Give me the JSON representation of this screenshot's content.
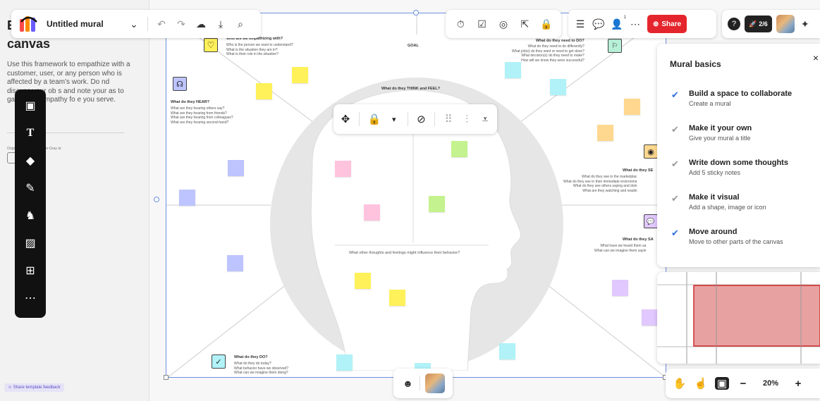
{
  "left_panel": {
    "title_visible": "E",
    "title_line2": "canvas",
    "description": "Use this framework to empathize with a customer, user, or any person who is affected by a team's work. Do   nd discuss your ob   s and note your as   to gain more empathy fo   e you serve.",
    "credit": "Originally created by Dave Gray at",
    "feedback": "Share template feedback"
  },
  "top_left_bar": {
    "mural_title": "Untitled mural"
  },
  "top_right_bar": {
    "share_label": "Share",
    "collaborator_count": "1"
  },
  "top_far_bar": {
    "progress_label": "2/6"
  },
  "board": {
    "empathize_label": "Who are we empathizing with?",
    "empathize_q": "Who is the person we want to understand?\nWhat is the situation they are in?\nWhat is their role in the situation?",
    "goal_label": "GOAL",
    "need_do_label": "What do they need to DO?",
    "need_do_q": "What do they need to do differently?\nWhat job(s) do they want or need to get done?\nWhat decision(s) do they need to make?\nHow will we know they were successful?",
    "hear_label": "What do they HEAR?",
    "hear_q": "What are they hearing others say?\nWhat are they hearing from friends?\nWhat are they hearing from colleagues?\nWhat are they hearing second-hand?",
    "think_label": "What do they THINK and FEEL?",
    "see_label": "What do they SE",
    "see_q": "What do they see in the marketplac\nWhat do they see in their immediate environme\nWhat do they see others saying and doin\nWhat are they watching and readin",
    "say_label": "What do they SA",
    "say_q": "What have we heard them sa\nWhat can we imagine them sayin",
    "other_thoughts": "What other thoughts and feelings might influence their behavior?",
    "do_label": "What do they DO?",
    "do_q": "What do they do today?\nWhat behavior have we observed?\nWhat can we imagine them doing?"
  },
  "basics": {
    "title": "Mural basics",
    "close": "×",
    "steps": [
      {
        "title": "Build a space to collaborate",
        "sub": "Create a mural",
        "done": true
      },
      {
        "title": "Make it your own",
        "sub": "Give your mural a title",
        "done": false
      },
      {
        "title": "Write down some thoughts",
        "sub": "Add 5 sticky notes",
        "done": false
      },
      {
        "title": "Make it visual",
        "sub": "Add a shape, image or icon",
        "done": false
      },
      {
        "title": "Move around",
        "sub": "Move to other parts of the canvas",
        "done": true
      }
    ]
  },
  "zoom": {
    "value": "20%",
    "minus": "−",
    "plus": "+"
  },
  "colors": {
    "accent_blue": "#2f6fdb",
    "share_red": "#e5252d",
    "sticky_yellow": "#fff159",
    "sticky_pink": "#ffc3de",
    "sticky_green": "#c4f28e",
    "sticky_blue": "#bdc4ff",
    "sticky_cyan": "#b0f2f7",
    "sticky_orange": "#ffd88f",
    "sticky_purple": "#e1c8ff"
  }
}
